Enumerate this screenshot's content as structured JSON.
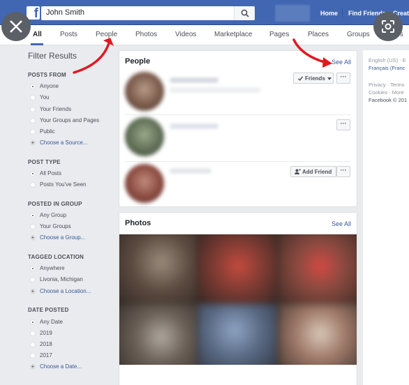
{
  "header": {
    "logo_letter": "f",
    "search_value": "John Smith",
    "nav_links": [
      "Home",
      "Find Friends",
      "Creat"
    ]
  },
  "tabs": [
    "All",
    "Posts",
    "People",
    "Photos",
    "Videos",
    "Marketplace",
    "Pages",
    "Places",
    "Groups",
    "Apps"
  ],
  "filters": {
    "title": "Filter Results",
    "sections": [
      {
        "heading": "POSTS FROM",
        "options": [
          "Anyone",
          "You",
          "Your Friends",
          "Your Groups and Pages",
          "Public"
        ],
        "link": "Choose a Source..."
      },
      {
        "heading": "POST TYPE",
        "options": [
          "All Posts",
          "Posts You've Seen"
        ]
      },
      {
        "heading": "POSTED IN GROUP",
        "options": [
          "Any Group",
          "Your Groups"
        ],
        "link": "Choose a Group..."
      },
      {
        "heading": "TAGGED LOCATION",
        "options": [
          "Anywhere",
          "Livonia, Michigan"
        ],
        "link": "Choose a Location..."
      },
      {
        "heading": "DATE POSTED",
        "options": [
          "Any Date",
          "2019",
          "2018",
          "2017"
        ],
        "link": "Choose a Date..."
      }
    ]
  },
  "people_card": {
    "title": "People",
    "see_all": "See All",
    "friends_button": "Friends",
    "add_friend_button": "Add Friend",
    "more_button": "···"
  },
  "photos_card": {
    "title": "Photos",
    "see_all": "See All"
  },
  "right_column": {
    "lang1": "English (US) · E",
    "lang2": "Français (Franc",
    "links1": "Privacy · Terms",
    "links2": "Cookies · More",
    "copyright": "Facebook © 201"
  },
  "colors": {
    "brand_blue": "#4267b2",
    "link_blue": "#365899",
    "annotation_red": "#e0191f"
  }
}
